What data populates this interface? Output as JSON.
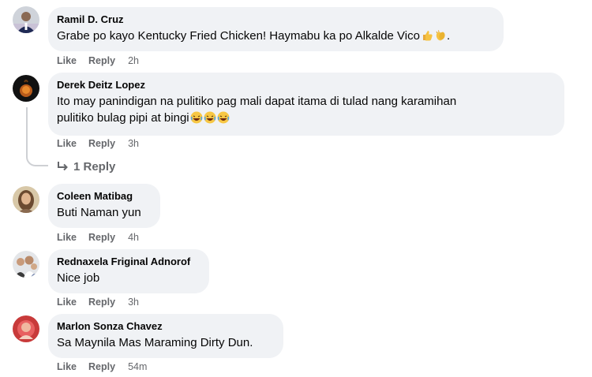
{
  "comments": [
    {
      "author": "Ramil D. Cruz",
      "text": "Grabe po kayo Kentucky Fried Chicken! Haymabu ka po Alkalde Vico",
      "text_suffix": ".",
      "emojis": [
        "thumbs-up-icon",
        "clapping-hands-icon"
      ],
      "like": "Like",
      "reply": "Reply",
      "time": "2h"
    },
    {
      "author": "Derek Deitz Lopez",
      "text_line1": "Ito may panindigan na pulitiko pag mali dapat itama di tulad nang karamihan",
      "text_line2": "pulitiko bulag pipi at bingi",
      "emojis": [
        "laughing-face-icon",
        "laughing-face-icon",
        "laughing-face-icon"
      ],
      "like": "Like",
      "reply": "Reply",
      "time": "3h",
      "replies_label": "1 Reply"
    },
    {
      "author": "Coleen Matibag",
      "text": "Buti Naman yun",
      "like": "Like",
      "reply": "Reply",
      "time": "4h"
    },
    {
      "author": "Rednaxela Friginal Adnorof",
      "text": "Nice job",
      "like": "Like",
      "reply": "Reply",
      "time": "3h"
    },
    {
      "author": "Marlon Sonza Chavez",
      "text": "Sa Maynila Mas Maraming Dirty Dun.",
      "like": "Like",
      "reply": "Reply",
      "time": "54m"
    }
  ],
  "colors": {
    "bubble": "#f0f2f5",
    "secondary_text": "#65676b",
    "primary_text": "#050505",
    "thread_line": "#ced0d4"
  }
}
